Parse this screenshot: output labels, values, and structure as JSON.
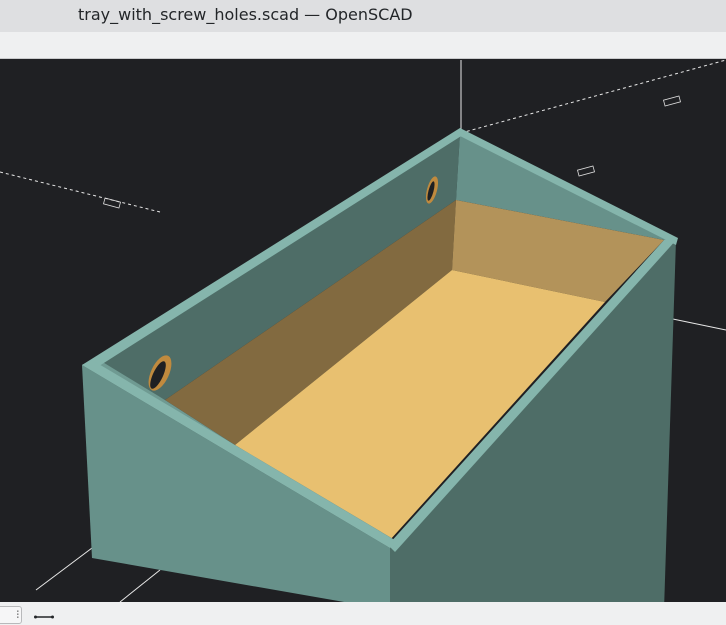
{
  "window": {
    "title": "tray_with_screw_holes.scad — OpenSCAD"
  },
  "colors": {
    "background": "#1f2023",
    "floor": "#e8c070",
    "wall_outer": "#67918a",
    "wall_dark": "#4e6d67",
    "rim": "#85b5ac"
  },
  "bottombar": {
    "view_button_icon": "view-toggle-icon",
    "measure_icon": "measure-distance-icon",
    "view_button_glyph": "⫶"
  }
}
